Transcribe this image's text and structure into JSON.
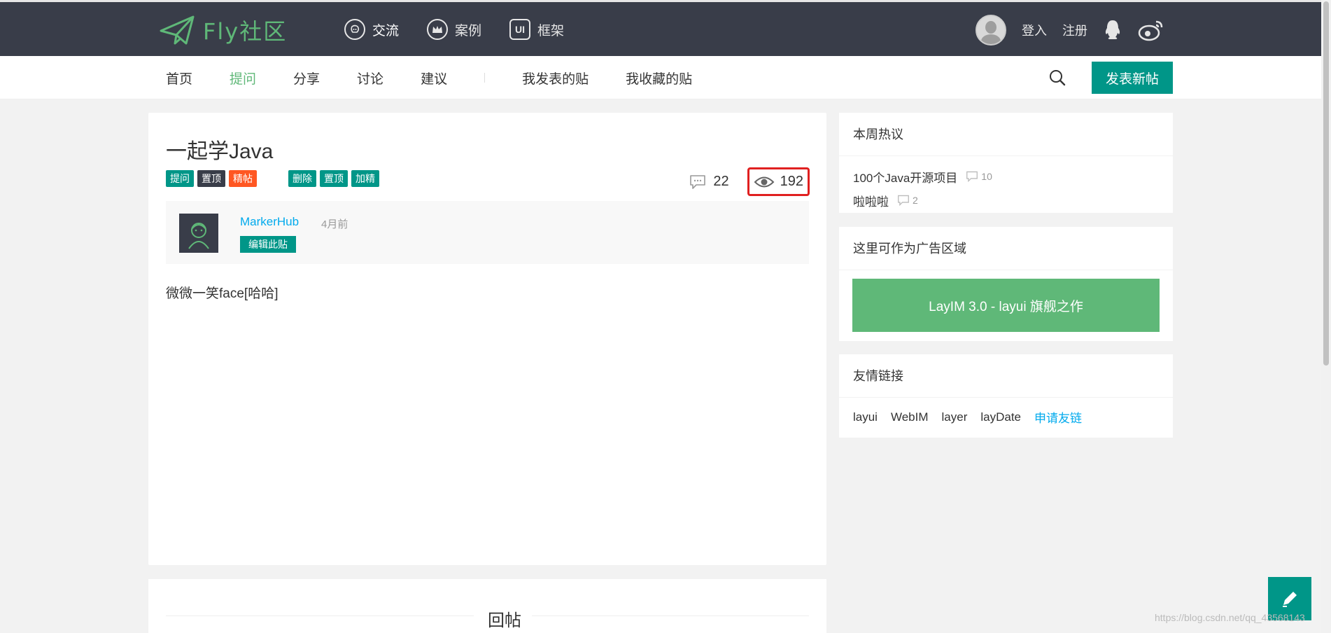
{
  "logo": {
    "text": "Fly社区"
  },
  "topnav": [
    {
      "label": "交流",
      "icon": "chat-icon"
    },
    {
      "label": "案例",
      "icon": "crown-icon"
    },
    {
      "label": "框架",
      "icon": "ui-icon"
    }
  ],
  "account": {
    "login": "登入",
    "register": "注册"
  },
  "subnav": {
    "items": [
      "首页",
      "提问",
      "分享",
      "讨论",
      "建议"
    ],
    "active": "提问",
    "user_items": [
      "我发表的贴",
      "我收藏的贴"
    ],
    "post_button": "发表新帖"
  },
  "post": {
    "title": "一起学Java",
    "tags": [
      {
        "label": "提问",
        "color": "#009688"
      },
      {
        "label": "置顶",
        "color": "#393d49"
      },
      {
        "label": "精帖",
        "color": "#ff5722"
      }
    ],
    "admin_actions": [
      "删除",
      "置顶",
      "加精"
    ],
    "comments": "22",
    "views": "192",
    "author": {
      "name": "MarkerHub",
      "time": "4月前",
      "edit_label": "编辑此贴"
    },
    "body": "微微一笑face[哈哈]"
  },
  "reply": {
    "title": "回帖"
  },
  "sidebar": {
    "hot": {
      "title": "本周热议",
      "items": [
        {
          "title": "100个Java开源项目",
          "count": "10"
        },
        {
          "title": "啦啦啦",
          "count": "2"
        }
      ]
    },
    "ad": {
      "title": "这里可作为广告区域",
      "banner": "LayIM 3.0 - layui 旗舰之作"
    },
    "links": {
      "title": "友情链接",
      "items": [
        "layui",
        "WebIM",
        "layer",
        "layDate"
      ],
      "apply": "申请友链"
    }
  },
  "watermark": "https://blog.csdn.net/qq_43568143",
  "colors": {
    "topbar": "#393d49",
    "accent": "#009688",
    "green": "#5fb878",
    "link": "#01aaed",
    "highlight_box": "#e02020"
  }
}
